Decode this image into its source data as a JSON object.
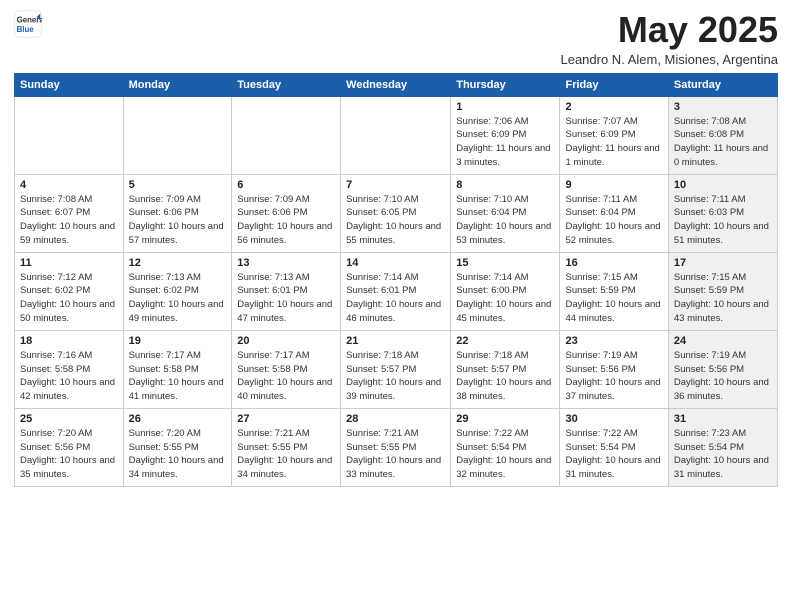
{
  "logo": {
    "general": "General",
    "blue": "Blue"
  },
  "title": "May 2025",
  "subtitle": "Leandro N. Alem, Misiones, Argentina",
  "days_of_week": [
    "Sunday",
    "Monday",
    "Tuesday",
    "Wednesday",
    "Thursday",
    "Friday",
    "Saturday"
  ],
  "weeks": [
    [
      {
        "day": "",
        "info": ""
      },
      {
        "day": "",
        "info": ""
      },
      {
        "day": "",
        "info": ""
      },
      {
        "day": "",
        "info": ""
      },
      {
        "day": "1",
        "info": "Sunrise: 7:06 AM\nSunset: 6:09 PM\nDaylight: 11 hours\nand 3 minutes."
      },
      {
        "day": "2",
        "info": "Sunrise: 7:07 AM\nSunset: 6:09 PM\nDaylight: 11 hours\nand 1 minute."
      },
      {
        "day": "3",
        "info": "Sunrise: 7:08 AM\nSunset: 6:08 PM\nDaylight: 11 hours\nand 0 minutes."
      }
    ],
    [
      {
        "day": "4",
        "info": "Sunrise: 7:08 AM\nSunset: 6:07 PM\nDaylight: 10 hours\nand 59 minutes."
      },
      {
        "day": "5",
        "info": "Sunrise: 7:09 AM\nSunset: 6:06 PM\nDaylight: 10 hours\nand 57 minutes."
      },
      {
        "day": "6",
        "info": "Sunrise: 7:09 AM\nSunset: 6:06 PM\nDaylight: 10 hours\nand 56 minutes."
      },
      {
        "day": "7",
        "info": "Sunrise: 7:10 AM\nSunset: 6:05 PM\nDaylight: 10 hours\nand 55 minutes."
      },
      {
        "day": "8",
        "info": "Sunrise: 7:10 AM\nSunset: 6:04 PM\nDaylight: 10 hours\nand 53 minutes."
      },
      {
        "day": "9",
        "info": "Sunrise: 7:11 AM\nSunset: 6:04 PM\nDaylight: 10 hours\nand 52 minutes."
      },
      {
        "day": "10",
        "info": "Sunrise: 7:11 AM\nSunset: 6:03 PM\nDaylight: 10 hours\nand 51 minutes."
      }
    ],
    [
      {
        "day": "11",
        "info": "Sunrise: 7:12 AM\nSunset: 6:02 PM\nDaylight: 10 hours\nand 50 minutes."
      },
      {
        "day": "12",
        "info": "Sunrise: 7:13 AM\nSunset: 6:02 PM\nDaylight: 10 hours\nand 49 minutes."
      },
      {
        "day": "13",
        "info": "Sunrise: 7:13 AM\nSunset: 6:01 PM\nDaylight: 10 hours\nand 47 minutes."
      },
      {
        "day": "14",
        "info": "Sunrise: 7:14 AM\nSunset: 6:01 PM\nDaylight: 10 hours\nand 46 minutes."
      },
      {
        "day": "15",
        "info": "Sunrise: 7:14 AM\nSunset: 6:00 PM\nDaylight: 10 hours\nand 45 minutes."
      },
      {
        "day": "16",
        "info": "Sunrise: 7:15 AM\nSunset: 5:59 PM\nDaylight: 10 hours\nand 44 minutes."
      },
      {
        "day": "17",
        "info": "Sunrise: 7:15 AM\nSunset: 5:59 PM\nDaylight: 10 hours\nand 43 minutes."
      }
    ],
    [
      {
        "day": "18",
        "info": "Sunrise: 7:16 AM\nSunset: 5:58 PM\nDaylight: 10 hours\nand 42 minutes."
      },
      {
        "day": "19",
        "info": "Sunrise: 7:17 AM\nSunset: 5:58 PM\nDaylight: 10 hours\nand 41 minutes."
      },
      {
        "day": "20",
        "info": "Sunrise: 7:17 AM\nSunset: 5:58 PM\nDaylight: 10 hours\nand 40 minutes."
      },
      {
        "day": "21",
        "info": "Sunrise: 7:18 AM\nSunset: 5:57 PM\nDaylight: 10 hours\nand 39 minutes."
      },
      {
        "day": "22",
        "info": "Sunrise: 7:18 AM\nSunset: 5:57 PM\nDaylight: 10 hours\nand 38 minutes."
      },
      {
        "day": "23",
        "info": "Sunrise: 7:19 AM\nSunset: 5:56 PM\nDaylight: 10 hours\nand 37 minutes."
      },
      {
        "day": "24",
        "info": "Sunrise: 7:19 AM\nSunset: 5:56 PM\nDaylight: 10 hours\nand 36 minutes."
      }
    ],
    [
      {
        "day": "25",
        "info": "Sunrise: 7:20 AM\nSunset: 5:56 PM\nDaylight: 10 hours\nand 35 minutes."
      },
      {
        "day": "26",
        "info": "Sunrise: 7:20 AM\nSunset: 5:55 PM\nDaylight: 10 hours\nand 34 minutes."
      },
      {
        "day": "27",
        "info": "Sunrise: 7:21 AM\nSunset: 5:55 PM\nDaylight: 10 hours\nand 34 minutes."
      },
      {
        "day": "28",
        "info": "Sunrise: 7:21 AM\nSunset: 5:55 PM\nDaylight: 10 hours\nand 33 minutes."
      },
      {
        "day": "29",
        "info": "Sunrise: 7:22 AM\nSunset: 5:54 PM\nDaylight: 10 hours\nand 32 minutes."
      },
      {
        "day": "30",
        "info": "Sunrise: 7:22 AM\nSunset: 5:54 PM\nDaylight: 10 hours\nand 31 minutes."
      },
      {
        "day": "31",
        "info": "Sunrise: 7:23 AM\nSunset: 5:54 PM\nDaylight: 10 hours\nand 31 minutes."
      }
    ]
  ]
}
